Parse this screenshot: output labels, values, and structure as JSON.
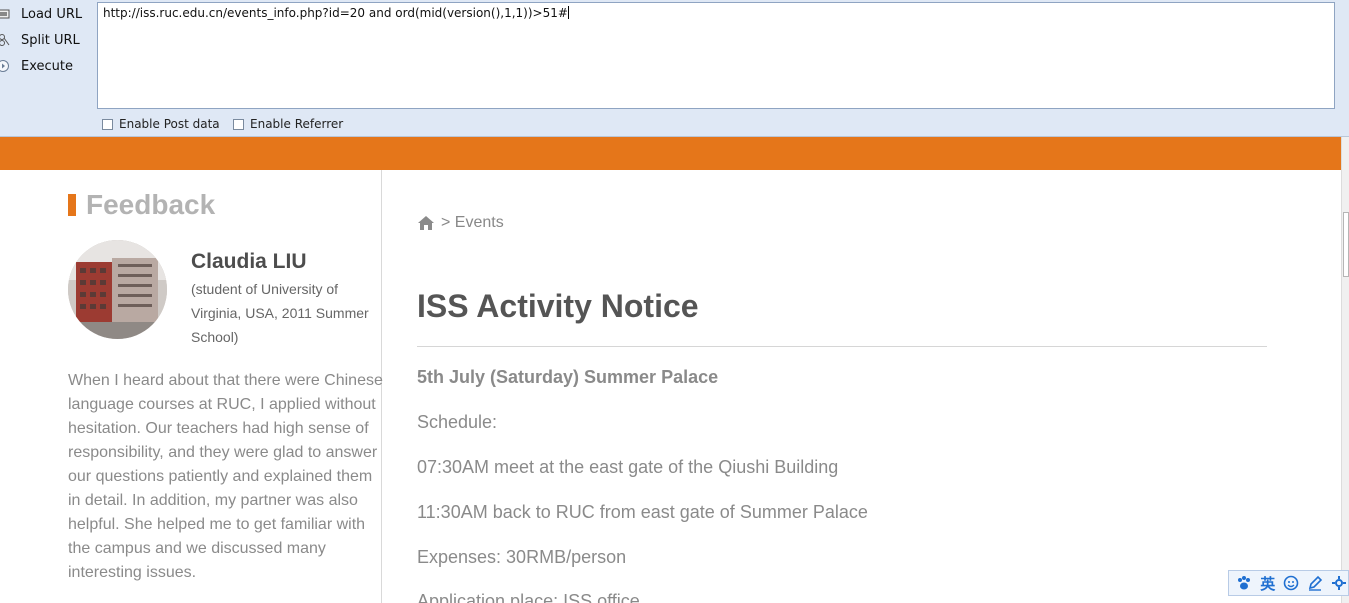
{
  "toolbar": {
    "load_url": "Load URL",
    "split_url": "Split URL",
    "execute": "Execute",
    "url_value": "http://iss.ruc.edu.cn/events_info.php?id=20 and ord(mid(version(),1,1))>51#",
    "enable_post_data": "Enable Post data",
    "enable_referrer": "Enable Referrer"
  },
  "feedback": {
    "title": "Feedback",
    "name": "Claudia LIU",
    "description": "(student of University of Virginia, USA, 2011 Summer School)",
    "testimonial": "When I heard about that there were Chinese language courses at RUC, I applied without hesitation. Our teachers had high sense of responsibility, and they were glad to answer our questions patiently and explained them in detail. In addition, my partner was also helpful. She helped me to get familiar with the campus and we discussed many interesting issues."
  },
  "breadcrumb": {
    "separator": ">",
    "current": "Events"
  },
  "notice": {
    "title": "ISS Activity Notice",
    "lines": [
      "5th July (Saturday) Summer Palace",
      "Schedule:",
      "07:30AM  meet at the east gate of the Qiushi Building",
      "11:30AM  back to RUC from east gate of Summer Palace",
      "Expenses: 30RMB/person",
      "Application place: ISS office"
    ]
  },
  "ime": {
    "items": [
      "paw-icon",
      "英",
      "smiley-icon",
      "pen-icon",
      "settings-icon"
    ]
  },
  "colors": {
    "accent_orange": "#e5761a",
    "toolbar_bg": "#dfe8f5"
  }
}
